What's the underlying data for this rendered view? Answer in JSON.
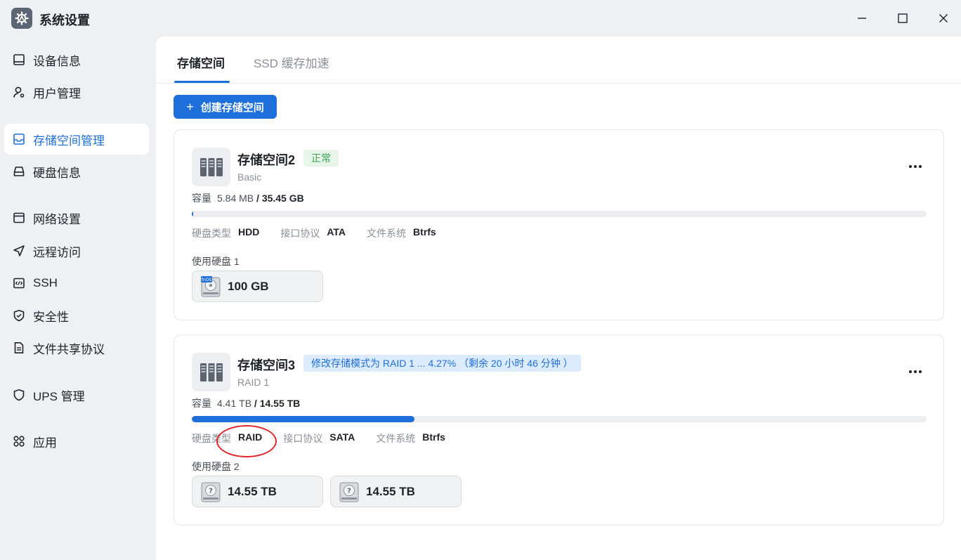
{
  "window": {
    "title": "系统设置",
    "minimize_icon": "minimize-icon",
    "maximize_icon": "maximize-icon",
    "close_icon": "close-icon"
  },
  "sidebar": {
    "items": [
      {
        "label": "设备信息",
        "icon": "monitor-icon"
      },
      {
        "label": "用户管理",
        "icon": "user-gear-icon"
      },
      {
        "label": "存储空间管理",
        "icon": "storage-icon",
        "active": true
      },
      {
        "label": "硬盘信息",
        "icon": "harddisk-icon"
      },
      {
        "label": "网络设置",
        "icon": "network-icon"
      },
      {
        "label": "远程访问",
        "icon": "send-icon"
      },
      {
        "label": "SSH",
        "icon": "code-icon"
      },
      {
        "label": "安全性",
        "icon": "shield-check-icon"
      },
      {
        "label": "文件共享协议",
        "icon": "file-icon"
      },
      {
        "label": "UPS 管理",
        "icon": "shield-icon"
      },
      {
        "label": "应用",
        "icon": "apps-icon"
      }
    ]
  },
  "tabs": [
    {
      "label": "存储空间",
      "active": true
    },
    {
      "label": "SSD 缓存加速",
      "active": false
    }
  ],
  "create_button": {
    "plus": "+",
    "label": "创建存储空间"
  },
  "pools": [
    {
      "name": "存储空间2",
      "status": "正常",
      "raid": "Basic",
      "capacity_label": "容量",
      "used": "5.84 MB",
      "separator": "/",
      "total": "35.45 GB",
      "usage_fraction": 0.0002,
      "disk_type_label": "硬盘类型",
      "disk_type": "HDD",
      "interface_label": "接口协议",
      "interface": "ATA",
      "fs_label": "文件系统",
      "fs": "Btrfs",
      "disks_label": "使用硬盘 1",
      "disks": [
        {
          "size": "100 GB",
          "icon": "fnos-disk-icon"
        }
      ]
    },
    {
      "name": "存储空间3",
      "status": "修改存储模式为 RAID 1 ... 4.27% （剩余 20 小时 46 分钟 ）",
      "raid": "RAID 1",
      "capacity_label": "容量",
      "used": "4.41 TB",
      "separator": "/",
      "total": "14.55 TB",
      "usage_fraction": 0.303,
      "disk_type_label": "硬盘类型",
      "disk_type": "RAID",
      "interface_label": "接口协议",
      "interface": "SATA",
      "fs_label": "文件系统",
      "fs": "Btrfs",
      "disks_label": "使用硬盘 2",
      "disks": [
        {
          "size": "14.55 TB",
          "icon": "unknown-disk-icon"
        },
        {
          "size": "14.55 TB",
          "icon": "unknown-disk-icon"
        }
      ]
    }
  ],
  "colors": {
    "accent": "#1e6fd9",
    "ok": "#3aa451",
    "annotation": "#e0262a"
  }
}
